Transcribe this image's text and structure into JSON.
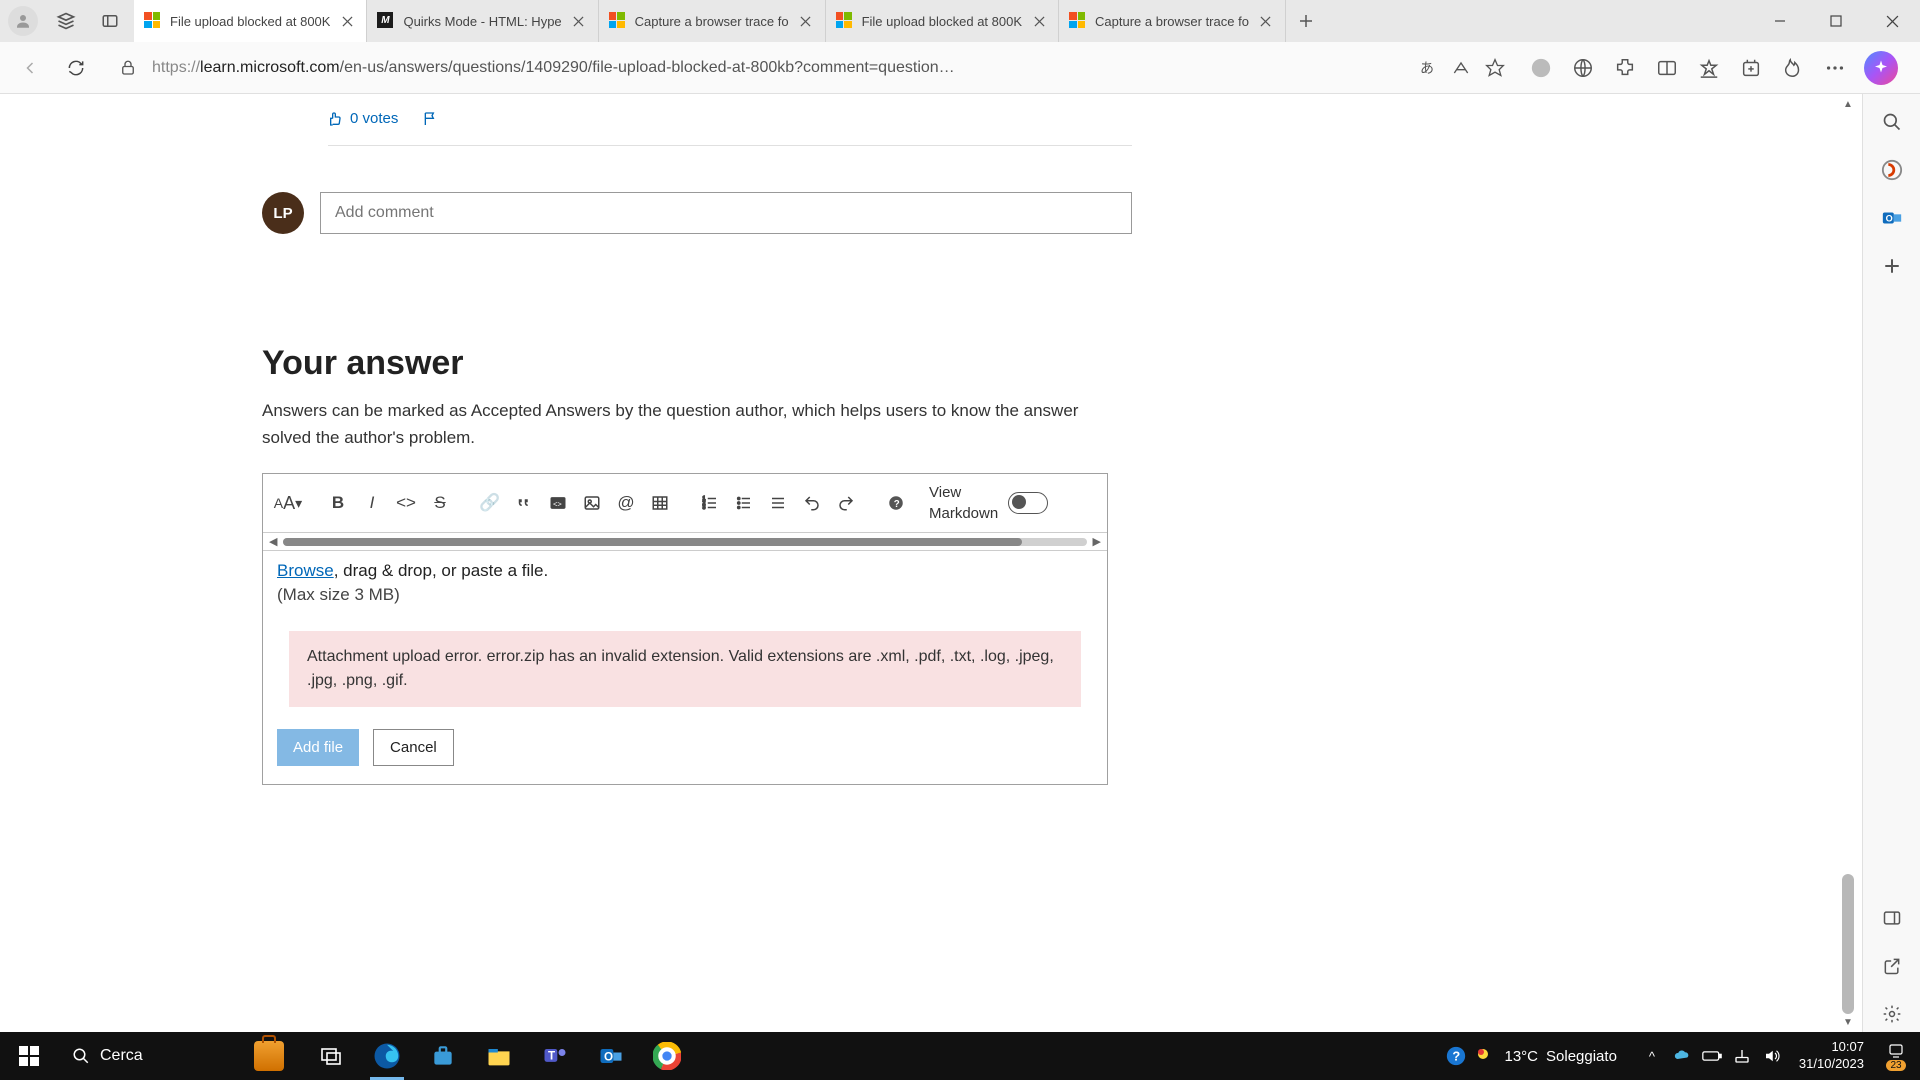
{
  "window": {
    "tabs": [
      {
        "title": "File upload blocked at 800K",
        "fav": "ms"
      },
      {
        "title": "Quirks Mode - HTML: Hype",
        "fav": "mdn"
      },
      {
        "title": "Capture a browser trace fo",
        "fav": "ms"
      },
      {
        "title": "File upload blocked at 800K",
        "fav": "ms"
      },
      {
        "title": "Capture a browser trace fo",
        "fav": "ms"
      }
    ],
    "url_proto": "https://",
    "url_host": "learn.microsoft.com",
    "url_path": "/en-us/answers/questions/1409290/file-upload-blocked-at-800kb?comment=question…"
  },
  "page": {
    "votes": "0 votes",
    "avatar": "LP",
    "comment_placeholder": "Add comment",
    "answer_heading": "Your answer",
    "answer_desc": "Answers can be marked as Accepted Answers by the question author, which helps users to know the answer solved the author's problem.",
    "view_md_line1": "View",
    "view_md_line2": "Markdown",
    "browse_link": "Browse",
    "browse_rest": ", drag & drop, or paste a file.",
    "max_size": "(Max size 3 MB)",
    "error_msg": "Attachment upload error. error.zip has an invalid extension. Valid extensions are .xml, .pdf, .txt, .log, .jpeg, .jpg, .png, .gif.",
    "add_file": "Add file",
    "cancel": "Cancel"
  },
  "taskbar": {
    "search": "Cerca",
    "weather_temp": "13°C",
    "weather_cond": "Soleggiato",
    "time": "10:07",
    "date": "31/10/2023",
    "notif": "23"
  }
}
